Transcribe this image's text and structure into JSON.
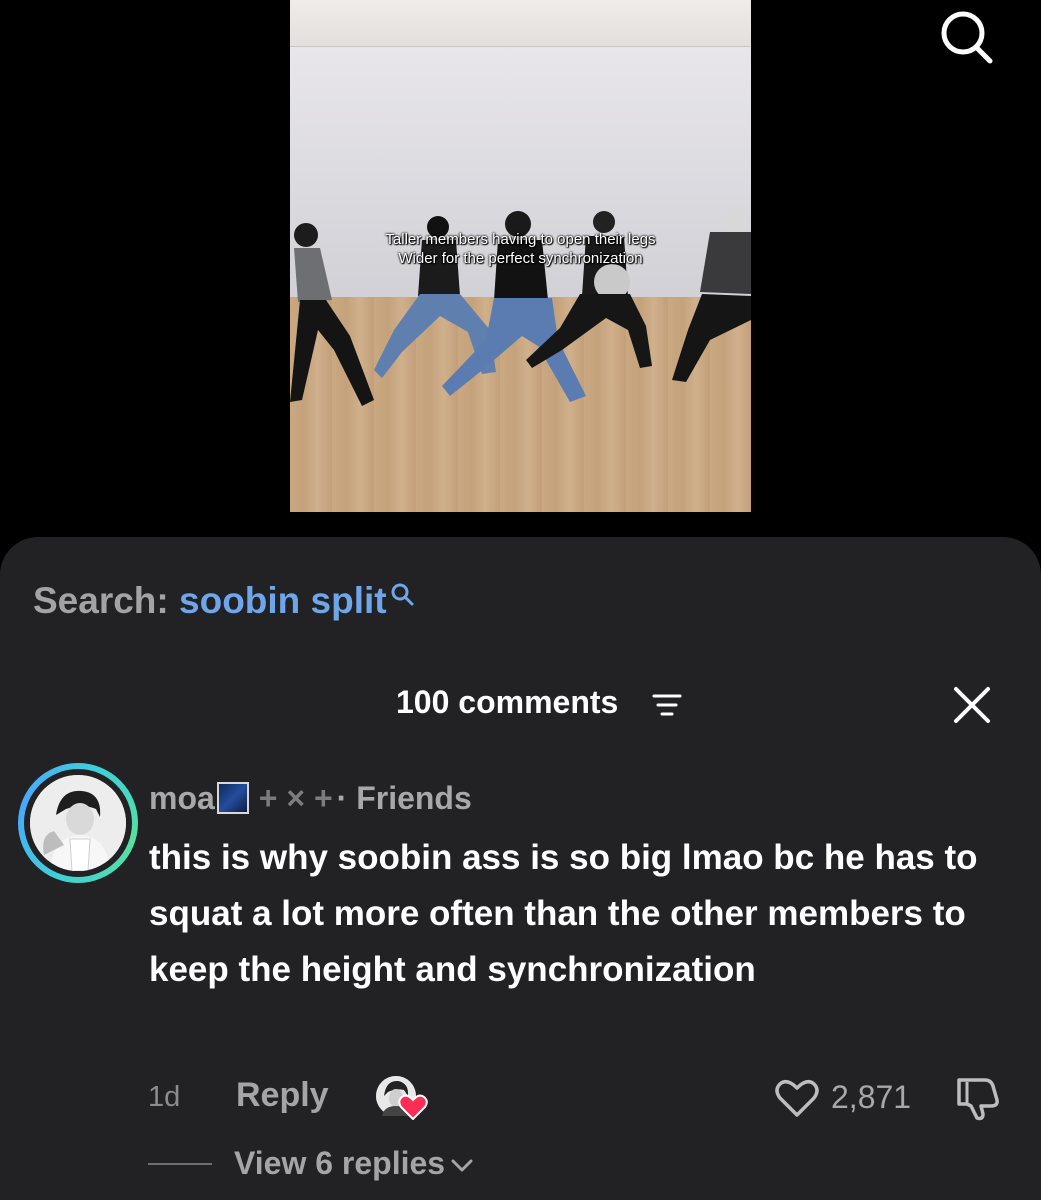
{
  "video": {
    "caption_line1": "Taller members having to open their legs",
    "caption_line2": "Wider for the perfect synchronization"
  },
  "top_bar": {
    "search_icon": "search-icon"
  },
  "search_suggestion": {
    "label": "Search:",
    "query": "soobin split",
    "query_color": "#6fa6ea"
  },
  "comments": {
    "header": "100 comments",
    "sort_icon": "sort-icon",
    "close_icon": "close-icon",
    "items": [
      {
        "username": "moa",
        "decoration": "+ × +",
        "relation": "· Friends",
        "text": "this is why soobin ass is so big lmao bc he has to squat a lot more often than the other members to keep the height and synchronization",
        "time": "1d",
        "reply_label": "Reply",
        "likes": "2,871",
        "view_replies": "View 6 replies"
      }
    ]
  }
}
